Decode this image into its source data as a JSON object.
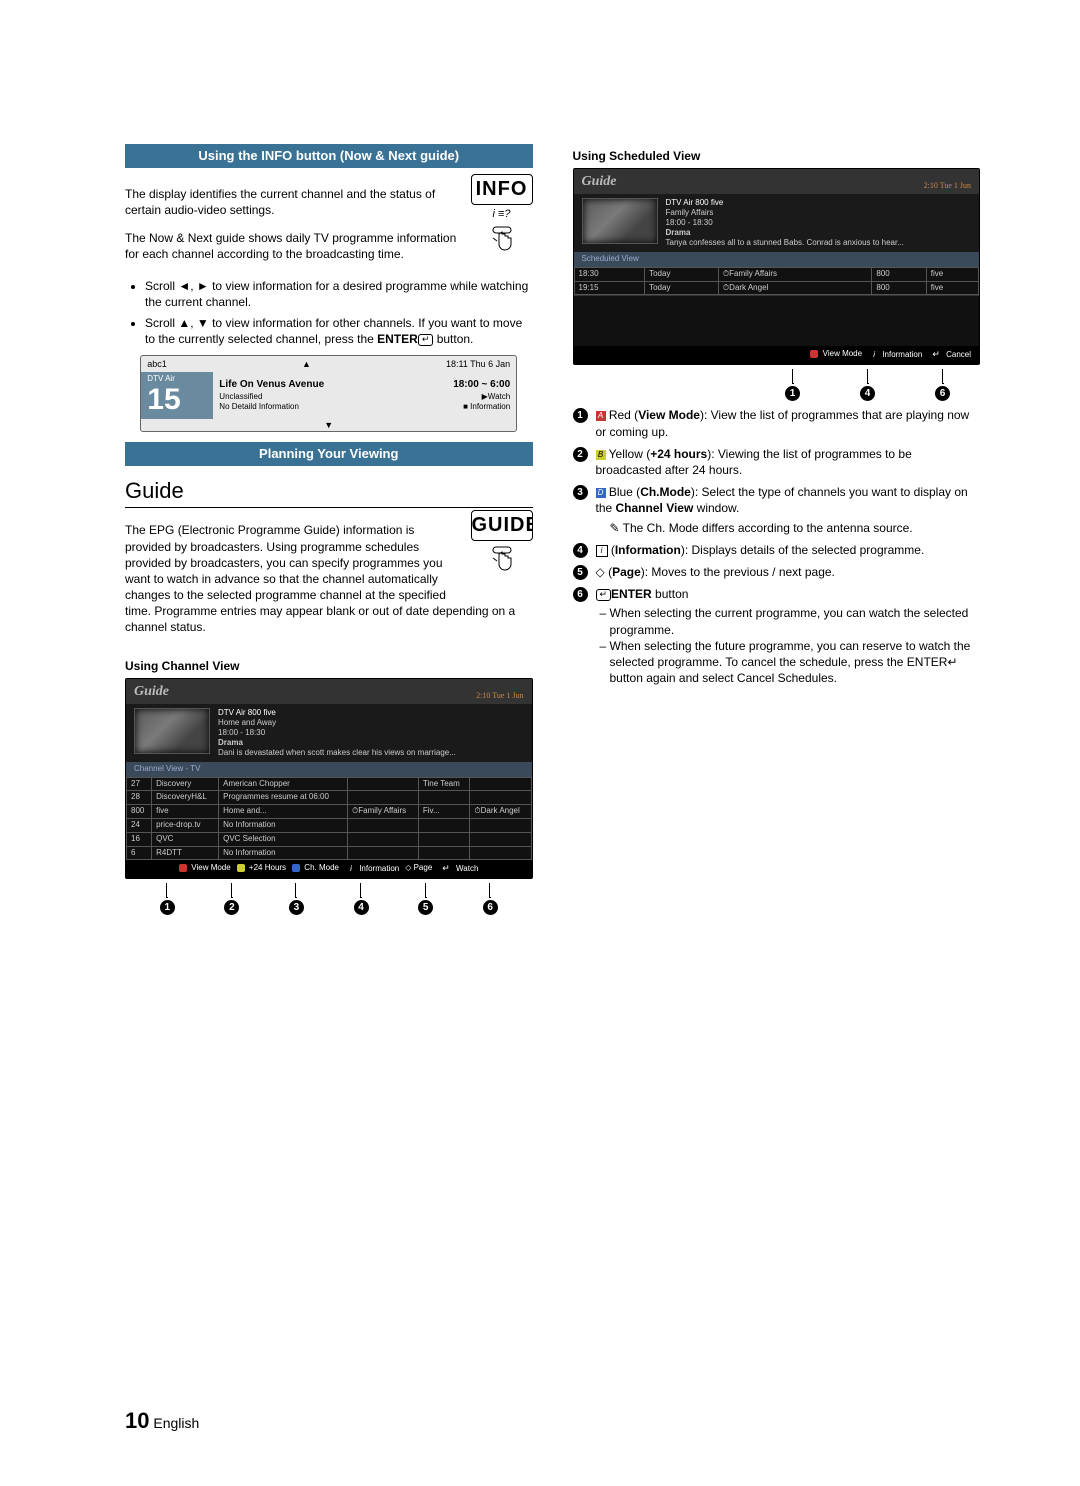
{
  "page_number": "10",
  "page_lang": "English",
  "sections": {
    "info_heading": "Using the INFO button (Now & Next guide)",
    "info_p1": "The display identifies the current channel and the status of certain audio-video settings.",
    "info_p2": "The Now & Next guide shows daily TV programme information for each channel according to the broadcasting time.",
    "info_b1": "Scroll ◄, ► to view information for a desired programme while watching the current channel.",
    "info_b2_a": "Scroll ▲, ▼ to view information for other channels. If you want to move to the currently selected channel, press the ",
    "info_b2_b": "ENTER",
    "info_b2_c": " button.",
    "info_badge": "INFO",
    "info_badge_sub": "i  ≡?",
    "mini": {
      "topleft": "abc1",
      "topright": "18:11 Thu 6 Jan",
      "air": "DTV Air",
      "chnum": "15",
      "prog": "Life On Venus Avenue",
      "time": "18:00 ~ 6:00",
      "row2a": "Unclassified",
      "row2b": "▶Watch",
      "row3a": "No Detaild Information",
      "row3b": "■ Information"
    },
    "plan_heading": "Planning Your Viewing",
    "guide_title": "Guide",
    "guide_p": "The EPG (Electronic Programme Guide) information is provided by broadcasters. Using programme schedules provided by broadcasters, you can specify programmes you want to watch in advance so that the channel automatically changes to the selected programme channel at the specified time. Programme entries may appear blank or out of date depending on a channel status.",
    "guide_badge": "GUIDE",
    "chview_head": "Using  Channel View",
    "shot1": {
      "title": "Guide",
      "date": "2:10 Tue 1 Jun",
      "src": "DTV Air 800 five",
      "prog": "Home and Away",
      "time": "18:00 - 18:30",
      "genre": "Drama",
      "desc": "Dani is devastated when scott makes clear his views on marriage...",
      "subbar": "Channel View - TV",
      "rows": [
        [
          "27",
          "Discovery",
          "American Chopper",
          "",
          "Tine Team",
          ""
        ],
        [
          "28",
          "DiscoveryH&L",
          "Programmes resume at 06:00",
          "",
          "",
          ""
        ],
        [
          "800",
          "five",
          "Home and...",
          "⏱Family Affairs",
          "Fiv...",
          "⏱Dark Angel"
        ],
        [
          "24",
          "price-drop.tv",
          "No Information",
          "",
          "",
          ""
        ],
        [
          "16",
          "QVC",
          "QVC Selection",
          "",
          "",
          ""
        ],
        [
          "6",
          "R4DTT",
          "No Information",
          "",
          "",
          ""
        ]
      ],
      "toolbar": [
        "View Mode",
        "+24 Hours",
        "Ch. Mode",
        "Information",
        "Page",
        "Watch"
      ],
      "toolbar_icons": [
        "red",
        "yel",
        "blu",
        "i",
        "updown",
        "enter"
      ],
      "callouts": [
        "1",
        "2",
        "3",
        "4",
        "5",
        "6"
      ]
    },
    "schview_head": "Using Scheduled View",
    "shot2": {
      "title": "Guide",
      "date": "2:10 Tue 1 Jun",
      "src": "DTV Air 800 five",
      "prog": "Family Affairs",
      "time": "18:00 - 18:30",
      "genre": "Drama",
      "desc": "Tanya confesses all to a stunned Babs. Conrad is anxious to hear...",
      "subbar": "Scheduled View",
      "rows": [
        [
          "18:30",
          "Today",
          "⏱Family Affairs",
          "800",
          "five"
        ],
        [
          "19:15",
          "Today",
          "⏱Dark Angel",
          "800",
          "five"
        ]
      ],
      "toolbar": [
        "View Mode",
        "Information",
        "Cancel"
      ],
      "toolbar_icons": [
        "red",
        "i",
        "enter"
      ],
      "callouts": [
        "1",
        "4",
        "6"
      ]
    },
    "legend": [
      {
        "n": "1",
        "pre": "A",
        "preClass": "sqA",
        "body_a": " Red (",
        "body_b": "View Mode",
        "body_c": "): View the list of programmes that are playing now or coming up."
      },
      {
        "n": "2",
        "pre": "B",
        "preClass": "sqB",
        "body_a": " Yellow (",
        "body_b": "+24 hours",
        "body_c": "): Viewing the list of programmes to be broadcasted after 24 hours."
      },
      {
        "n": "3",
        "pre": "D",
        "preClass": "sqD",
        "body_a": " Blue (",
        "body_b": "Ch.Mode",
        "body_c": "): Select the type of channels you want to display on the ",
        "tail": "Channel View",
        "tail2": " window.",
        "note": "The Ch. Mode differs according to the antenna source."
      },
      {
        "n": "4",
        "icon": "i",
        "body_a": " (",
        "body_b": "Information",
        "body_c": "): Displays details of the selected programme."
      },
      {
        "n": "5",
        "icon": "updown",
        "body_a": " (",
        "body_b": "Page",
        "body_c": "): Moves to the previous / next page."
      },
      {
        "n": "6",
        "icon": "enter",
        "body_a": "",
        "body_b": "ENTER",
        "body_c": " button",
        "subs": [
          "When selecting the current programme, you can watch the selected programme.",
          "When selecting the future programme, you can reserve to watch the selected programme. To cancel the schedule, press the ENTER↵ button again and select Cancel Schedules."
        ]
      }
    ]
  }
}
